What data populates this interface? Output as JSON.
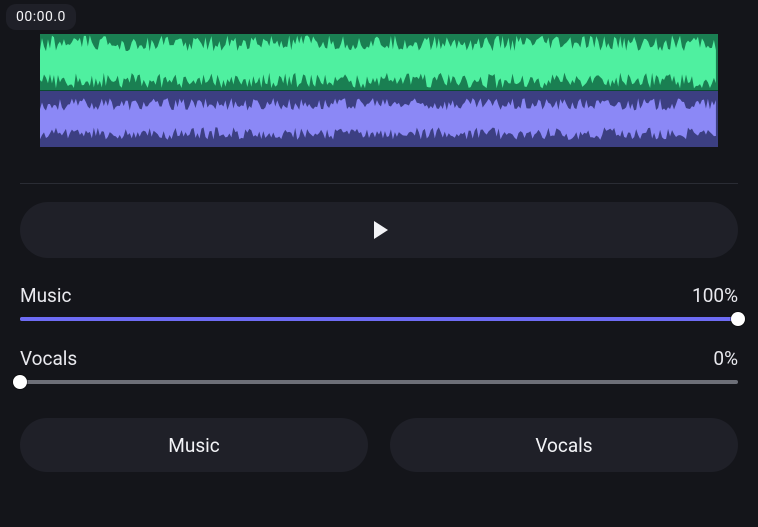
{
  "playhead": {
    "time": "00:00.0"
  },
  "tracks": {
    "a": {
      "color": "#4ff0a0",
      "bg": "#1a7f52"
    },
    "b": {
      "color": "#8b88f6",
      "bg": "#3c3f82"
    }
  },
  "transport": {
    "play_icon": "play"
  },
  "sliders": {
    "music": {
      "label": "Music",
      "value_text": "100%",
      "percent": 100,
      "fill_color": "#6e6cf4"
    },
    "vocals": {
      "label": "Vocals",
      "value_text": "0%",
      "percent": 0,
      "fill_color": "#6e6cf4"
    }
  },
  "tabs": {
    "music": {
      "label": "Music"
    },
    "vocals": {
      "label": "Vocals"
    }
  }
}
